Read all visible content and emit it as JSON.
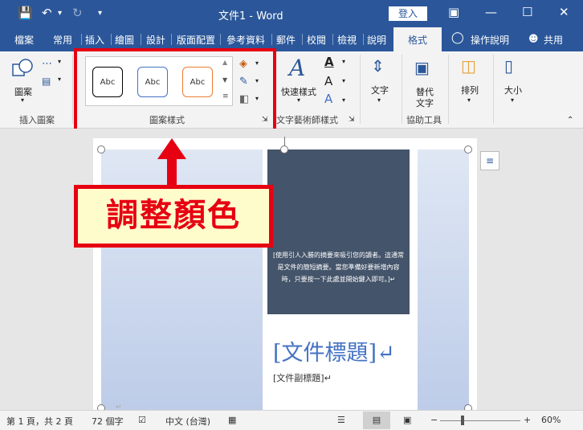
{
  "title": "文件1 - Word",
  "login": "登入",
  "tabs": [
    "檔案",
    "常用",
    "插入",
    "繪圖",
    "設計",
    "版面配置",
    "參考資料",
    "郵件",
    "校閱",
    "檢視",
    "說明",
    "格式"
  ],
  "tell_me": "操作說明",
  "share": "共用",
  "ribbon": {
    "shapes": "圖案",
    "insert_shapes_group": "插入圖案",
    "style_sample": "Abc",
    "shape_styles_group": "圖案樣式",
    "quick_styles": "快速樣式",
    "wordart_group": "文字藝術師樣式",
    "text": "文字",
    "alt_text_line1": "替代",
    "alt_text_line2": "文字",
    "accessibility_group": "協助工具",
    "arrange": "排列",
    "size": "大小"
  },
  "document": {
    "abstract": "[使用引人入勝的摘要來吸引您的讀者。這通常是文件的簡短摘要。當您準備好要新增內容時，只要按一下此處並開始鍵入即可。]↵",
    "title": "[文件標題]↵",
    "subtitle": "[文件副標題]↵"
  },
  "callout": "調整顏色",
  "status": {
    "page": "第 1 頁，共 2 頁",
    "words": "72 個字",
    "language": "中文 (台灣)",
    "zoom": "60%"
  },
  "colors": {
    "titlebar": "#2b579a",
    "annotation_red": "#e60012",
    "callout_fill": "#fffccc",
    "dark_box": "#44546a",
    "title_blue": "#4472c4"
  }
}
